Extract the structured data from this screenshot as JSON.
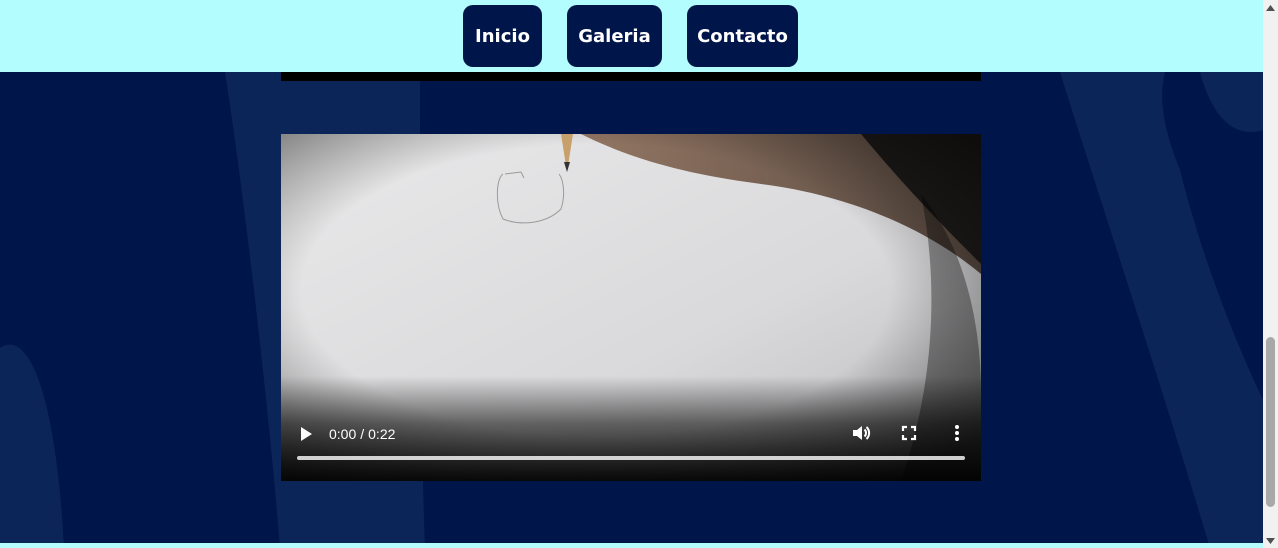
{
  "nav": {
    "inicio": "Inicio",
    "galeria": "Galeria",
    "contacto": "Contacto"
  },
  "video": {
    "current_time": "0:00",
    "separator": "/",
    "duration": "0:22",
    "progress_fraction": 0
  },
  "icons": {
    "play": "play-icon",
    "volume": "volume-icon",
    "fullscreen": "fullscreen-icon",
    "more": "more-vertical-icon"
  },
  "colors": {
    "nav_background": "#b3fdff",
    "page_background": "#00154a",
    "button_background": "#00154a",
    "button_text": "#ffffff"
  }
}
